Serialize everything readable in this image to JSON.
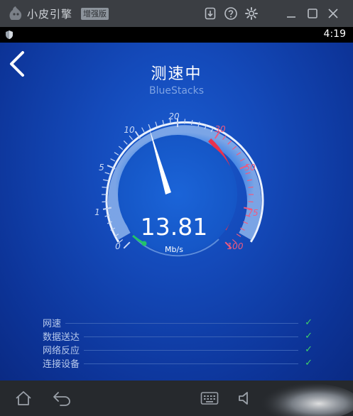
{
  "window": {
    "app_title": "小皮引擎",
    "edition_badge": "增强版",
    "icons": [
      "app-logo-icon",
      "download-icon",
      "help-icon",
      "settings-icon",
      "minimize-icon",
      "maximize-icon",
      "close-icon"
    ]
  },
  "status_bar": {
    "time": "4:19",
    "icons": [
      "shield-icon"
    ]
  },
  "screen": {
    "title": "测速中",
    "subtitle": "BlueStacks",
    "back_icon": "back-arrow-icon"
  },
  "gauge": {
    "tick_labels": [
      "0",
      "1",
      "5",
      "10",
      "20",
      "30",
      "50",
      "75",
      "100"
    ],
    "speed_value": "13.81",
    "unit": "Mb/s",
    "colors": {
      "normal_tick": "#c9d8f5",
      "high_tick": "#f05a7e",
      "arc_red": "#e8324e",
      "progress_green": "#22c36a"
    }
  },
  "checklist": {
    "items": [
      {
        "label": "网速",
        "status": "done"
      },
      {
        "label": "数据送达",
        "status": "done"
      },
      {
        "label": "网络反应",
        "status": "done"
      },
      {
        "label": "连接设备",
        "status": "done"
      }
    ],
    "check_color": "#3fd06a"
  },
  "nav_bar": {
    "icons": [
      "home-icon",
      "back-icon",
      "keyboard-icon",
      "volume-icon"
    ]
  }
}
